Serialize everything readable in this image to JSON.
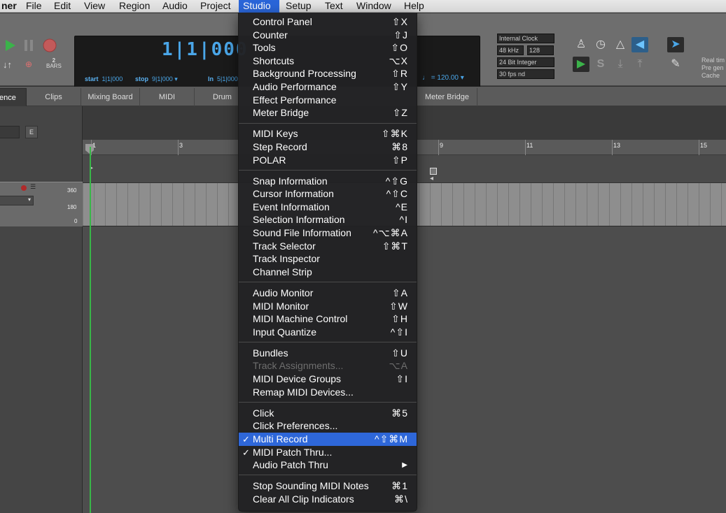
{
  "menubar": {
    "items": [
      "ner",
      "File",
      "Edit",
      "View",
      "Region",
      "Audio",
      "Project",
      "Studio",
      "Setup",
      "Text",
      "Window",
      "Help"
    ],
    "active": "Studio"
  },
  "counter": {
    "display": "1|1|000",
    "start_label": "start",
    "start_value": "1|1|000",
    "stop_label": "stop",
    "stop_value": "9|1|000",
    "in_label": "In",
    "in_value": "5|1|000",
    "tempo": "120.00",
    "bars_count": "2",
    "bars_label": "BARS"
  },
  "settings": {
    "clock": "Internal Clock",
    "sample_rate": "48 kHz",
    "buffer": "128",
    "bit_depth": "24 Bit Integer",
    "frame_rate": "30 fps nd"
  },
  "realtime": [
    "Real tim",
    "Pre gen",
    "Cache"
  ],
  "tabs": [
    "ence",
    "Clips",
    "Mixing Board",
    "MIDI",
    "Drum",
    "Meter Bridge"
  ],
  "track": {
    "e_label": "E",
    "levels": [
      "360",
      "180",
      "0"
    ]
  },
  "ruler": [
    "1",
    "3",
    "9",
    "11",
    "13",
    "15"
  ],
  "menu": {
    "groups": [
      [
        {
          "label": "Control Panel",
          "shortcut": "⇧X"
        },
        {
          "label": "Counter",
          "shortcut": "⇧J"
        },
        {
          "label": "Tools",
          "shortcut": "⇧O"
        },
        {
          "label": "Shortcuts",
          "shortcut": "⌥X"
        },
        {
          "label": "Background Processing",
          "shortcut": "⇧R"
        },
        {
          "label": "Audio Performance",
          "shortcut": "⇧Y"
        },
        {
          "label": "Effect Performance",
          "shortcut": ""
        },
        {
          "label": "Meter Bridge",
          "shortcut": "⇧Z"
        }
      ],
      [
        {
          "label": "MIDI Keys",
          "shortcut": "⇧⌘K"
        },
        {
          "label": "Step Record",
          "shortcut": "⌘8"
        },
        {
          "label": "POLAR",
          "shortcut": "⇧P"
        }
      ],
      [
        {
          "label": "Snap Information",
          "shortcut": "^⇧G"
        },
        {
          "label": "Cursor Information",
          "shortcut": "^⇧C"
        },
        {
          "label": "Event Information",
          "shortcut": "^E"
        },
        {
          "label": "Selection Information",
          "shortcut": "^I"
        },
        {
          "label": "Sound File Information",
          "shortcut": "^⌥⌘A"
        },
        {
          "label": "Track Selector",
          "shortcut": "⇧⌘T"
        },
        {
          "label": "Track Inspector",
          "shortcut": ""
        },
        {
          "label": "Channel Strip",
          "shortcut": ""
        }
      ],
      [
        {
          "label": "Audio Monitor",
          "shortcut": "⇧A"
        },
        {
          "label": "MIDI Monitor",
          "shortcut": "⇧W"
        },
        {
          "label": "MIDI Machine Control",
          "shortcut": "⇧H"
        },
        {
          "label": "Input Quantize",
          "shortcut": "^⇧I"
        }
      ],
      [
        {
          "label": "Bundles",
          "shortcut": "⇧U"
        },
        {
          "label": "Track Assignments...",
          "shortcut": "⌥A",
          "disabled": true
        },
        {
          "label": "MIDI Device Groups",
          "shortcut": "⇧I"
        },
        {
          "label": "Remap MIDI Devices...",
          "shortcut": ""
        }
      ],
      [
        {
          "label": "Click",
          "shortcut": "⌘5"
        },
        {
          "label": "Click Preferences...",
          "shortcut": ""
        },
        {
          "label": "Multi Record",
          "shortcut": "^⇧⌘M",
          "checked": true,
          "highlighted": true
        },
        {
          "label": "MIDI Patch Thru...",
          "shortcut": "",
          "checked": true
        },
        {
          "label": "Audio Patch Thru",
          "shortcut": "▶"
        }
      ],
      [
        {
          "label": "Stop Sounding MIDI Notes",
          "shortcut": "⌘1"
        },
        {
          "label": "Clear All Clip Indicators",
          "shortcut": "⌘\\"
        }
      ]
    ]
  }
}
